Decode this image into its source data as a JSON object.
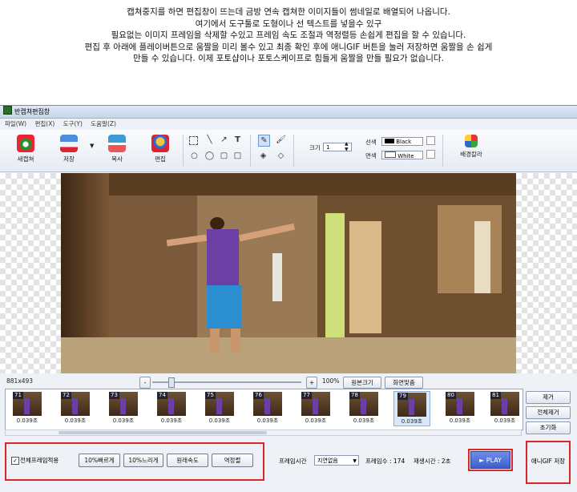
{
  "caption": {
    "lines": [
      "캡쳐중지를 하면 편집창이 뜨는데 금방 연속 캡쳐한 이미지들이 썸네일로 배열되어 나옵니다.",
      "여기에서 도구툴로 도형이나 선 텍스트를 넣을수 있구",
      "필요없는 이미지 프레임을 삭제할 수있고  프레임 속도 조절과 역정렬등 손쉽게 편집을 할 수 있습니다.",
      "편집 후 아래에 플레이버튼으로 움짤을 미리 볼수 있고 최종 확인 후에 애니GIF 버튼을 눌러 저장하면  움짤을 손 쉽게",
      "만들 수 있습니다. 이제 포토샵이나 포토스케이프로 힘들게 움짤을 만들 필요가 없습니다."
    ]
  },
  "window": {
    "title": "반캡쳐편집창",
    "menu": [
      "파일(W)",
      "편집(X)",
      "도구(Y)",
      "도움말(Z)"
    ]
  },
  "toolbar": {
    "new_capture": "새캡쳐",
    "save": "저장",
    "copy": "복사",
    "edit": "편집",
    "size_label": "크기",
    "size_value": "1",
    "line_color_label": "선색",
    "line_color_value": "Black",
    "fill_color_label": "면색",
    "fill_color_value": "White",
    "bg_color": "배경칼라"
  },
  "status": {
    "dimensions": "881x493",
    "zoom": "100%",
    "original_size": "원본크기",
    "fit_screen": "화면맞춤",
    "zoom_minus": "-",
    "zoom_plus": "+"
  },
  "frames": [
    {
      "num": "71",
      "delay": "0.039초"
    },
    {
      "num": "72",
      "delay": "0.039초"
    },
    {
      "num": "73",
      "delay": "0.039초"
    },
    {
      "num": "74",
      "delay": "0.039초"
    },
    {
      "num": "75",
      "delay": "0.039초"
    },
    {
      "num": "76",
      "delay": "0.039초"
    },
    {
      "num": "77",
      "delay": "0.039초"
    },
    {
      "num": "78",
      "delay": "0.039초"
    },
    {
      "num": "79",
      "delay": "0.039초"
    },
    {
      "num": "80",
      "delay": "0.039초"
    },
    {
      "num": "81",
      "delay": "0.039초"
    }
  ],
  "side_buttons": {
    "remove": "제거",
    "remove_all": "전체제거",
    "reset": "초기화"
  },
  "bottom": {
    "apply_all_label": "전체프레임적용",
    "faster": "10%빠르게",
    "slower": "10%느리게",
    "original_speed": "원래속도",
    "reverse": "역정렬",
    "frame_time_label": "프레임시간",
    "frame_time_value": "지연없음",
    "frame_count": "프레임수 : 174",
    "play_time": "재생시간 : 2초",
    "play": "► PLAY",
    "save_gif": "애니GIF 저장"
  }
}
